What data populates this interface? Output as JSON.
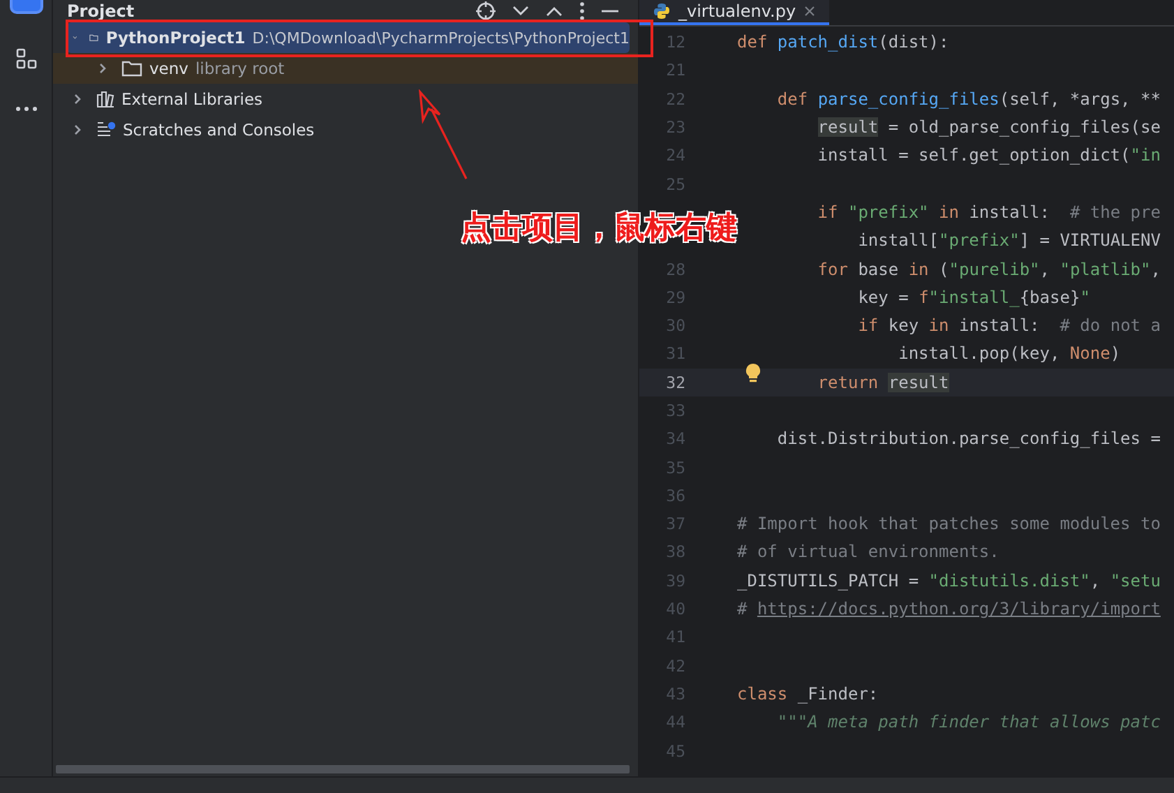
{
  "project_panel": {
    "title": "Project",
    "tree": [
      {
        "label": "PythonProject1",
        "path": "D:\\QMDownload\\PycharmProjects\\PythonProject1",
        "kind": "folder",
        "expanded": true,
        "selected": true,
        "children": [
          {
            "label": "venv",
            "note": "library root",
            "kind": "library-root",
            "expanded": false,
            "selected": false
          }
        ]
      },
      {
        "label": "External Libraries",
        "kind": "libraries",
        "expanded": false,
        "selected": false
      },
      {
        "label": "Scratches and Consoles",
        "kind": "scratches",
        "expanded": false,
        "selected": false
      }
    ]
  },
  "editor": {
    "tab": {
      "label": "_virtualenv.py",
      "selected": true
    },
    "lines": [
      {
        "number": "12",
        "current": false,
        "tokens": [
          {
            "kind": "kw",
            "text": "def "
          },
          {
            "kind": "fn",
            "text": "patch_dist"
          },
          {
            "kind": "plain",
            "text": "(dist):"
          }
        ]
      },
      {
        "number": "21",
        "current": false
      },
      {
        "number": "22",
        "current": false,
        "tokens": [
          {
            "kind": "kw",
            "text": "    def "
          },
          {
            "kind": "fn",
            "text": "parse_config_files"
          },
          {
            "kind": "plain",
            "text": "(self, *args, **"
          }
        ]
      },
      {
        "number": "23",
        "current": false,
        "tokens": [
          {
            "kind": "usage",
            "text": "        result"
          },
          {
            "kind": "plain",
            "text": " = old_parse_config_files(se"
          }
        ]
      },
      {
        "number": "24",
        "current": false,
        "tokens": [
          {
            "kind": "plain",
            "text": "        install = self.get_option_dict("
          },
          {
            "kind": "str",
            "text": "\"in"
          }
        ]
      },
      {
        "number": "25",
        "current": false
      },
      {
        "current": false,
        "tokens": [
          {
            "kind": "kw",
            "text": "        if "
          },
          {
            "kind": "str",
            "text": "\"prefix\""
          },
          {
            "kind": "kw",
            "text": " in "
          },
          {
            "kind": "plain",
            "text": "install:  "
          },
          {
            "kind": "cmt",
            "text": "# the pre"
          }
        ]
      },
      {
        "current": false,
        "tokens": [
          {
            "kind": "plain",
            "text": "            install["
          },
          {
            "kind": "str",
            "text": "\"prefix\""
          },
          {
            "kind": "plain",
            "text": "] = VIRTUALENV"
          }
        ]
      },
      {
        "number": "28",
        "current": false,
        "tokens": [
          {
            "kind": "kw",
            "text": "        for "
          },
          {
            "kind": "plain",
            "text": "base "
          },
          {
            "kind": "kw",
            "text": "in "
          },
          {
            "kind": "plain",
            "text": "("
          },
          {
            "kind": "str",
            "text": "\"purelib\""
          },
          {
            "kind": "plain",
            "text": ", "
          },
          {
            "kind": "str",
            "text": "\"platlib\""
          },
          {
            "kind": "plain",
            "text": ","
          }
        ]
      },
      {
        "number": "29",
        "current": false,
        "tokens": [
          {
            "kind": "plain",
            "text": "            key = "
          },
          {
            "kind": "kw",
            "text": "f"
          },
          {
            "kind": "str",
            "text": "\"install_"
          },
          {
            "kind": "plain",
            "text": "{base}"
          },
          {
            "kind": "str",
            "text": "\""
          }
        ]
      },
      {
        "number": "30",
        "current": false,
        "tokens": [
          {
            "kind": "kw",
            "text": "            if "
          },
          {
            "kind": "plain",
            "text": "key "
          },
          {
            "kind": "kw",
            "text": "in "
          },
          {
            "kind": "plain",
            "text": "install:  "
          },
          {
            "kind": "cmt",
            "text": "# do not a"
          }
        ]
      },
      {
        "number": "31",
        "current": false,
        "tokens": [
          {
            "kind": "plain",
            "text": "                install.pop(key, "
          },
          {
            "kind": "kw",
            "text": "None"
          },
          {
            "kind": "plain",
            "text": ")"
          }
        ]
      },
      {
        "number": "32",
        "current": true,
        "bulb": true,
        "tokens": [
          {
            "kind": "kw",
            "text": "        return "
          },
          {
            "kind": "usage",
            "text": "result"
          }
        ]
      },
      {
        "number": "33",
        "current": false
      },
      {
        "number": "34",
        "current": false,
        "tokens": [
          {
            "kind": "plain",
            "text": "    dist.Distribution.parse_config_files ="
          }
        ]
      },
      {
        "number": "35",
        "current": false
      },
      {
        "number": "36",
        "current": false
      },
      {
        "number": "37",
        "current": false,
        "tokens": [
          {
            "kind": "cmt",
            "text": "# Import hook that patches some modules to"
          }
        ]
      },
      {
        "number": "38",
        "current": false,
        "tokens": [
          {
            "kind": "cmt",
            "text": "# of virtual environments."
          }
        ]
      },
      {
        "number": "39",
        "current": false,
        "tokens": [
          {
            "kind": "plain",
            "text": "_DISTUTILS_PATCH = "
          },
          {
            "kind": "str",
            "text": "\"distutils.dist\""
          },
          {
            "kind": "plain",
            "text": ", "
          },
          {
            "kind": "str",
            "text": "\"setu"
          }
        ]
      },
      {
        "number": "40",
        "current": false,
        "tokens": [
          {
            "kind": "cmt",
            "text": "# "
          },
          {
            "kind": "link",
            "text": "https://docs.python.org/3/library/import"
          }
        ]
      },
      {
        "number": "41",
        "current": false
      },
      {
        "number": "42",
        "current": false
      },
      {
        "number": "43",
        "current": false,
        "tokens": [
          {
            "kind": "kw",
            "text": "class "
          },
          {
            "kind": "plain",
            "text": "_Finder:"
          }
        ]
      },
      {
        "number": "44",
        "current": false,
        "tokens": [
          {
            "kind": "doc",
            "text": "    \"\"\"A meta path finder that allows patc"
          }
        ]
      },
      {
        "number": "45",
        "current": false
      }
    ]
  },
  "annotation": {
    "text": "点击项目，鼠标右键"
  }
}
